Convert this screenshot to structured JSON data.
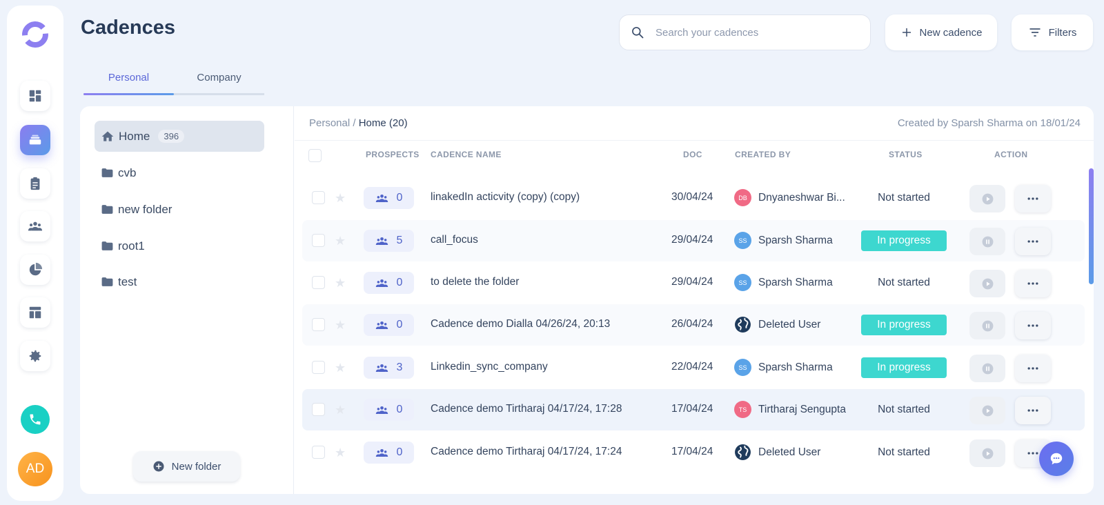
{
  "header": {
    "title": "Cadences",
    "search_placeholder": "Search your cadences",
    "new_cadence_label": "New cadence",
    "filters_label": "Filters"
  },
  "tabs": [
    {
      "label": "Personal",
      "active": true
    },
    {
      "label": "Company",
      "active": false
    }
  ],
  "sidebar": {
    "user_initials": "AD"
  },
  "folders": {
    "items": [
      {
        "label": "Home",
        "count": "396",
        "active": true
      },
      {
        "label": "cvb"
      },
      {
        "label": "new folder"
      },
      {
        "label": "root1"
      },
      {
        "label": "test"
      }
    ],
    "new_folder_label": "New folder"
  },
  "breadcrumb": {
    "root": "Personal /",
    "current": "Home (20)"
  },
  "created_info": "Created by Sparsh Sharma on 18/01/24",
  "table": {
    "columns": {
      "prospects": "PROSPECTS",
      "name": "CADENCE NAME",
      "doc": "DOC",
      "created_by": "CREATED BY",
      "status": "STATUS",
      "action": "ACTION"
    },
    "rows": [
      {
        "prospects": "0",
        "name": "linakedIn acticvity (copy) (copy)",
        "doc": "30/04/24",
        "creator_initials": "DB",
        "creator": "Dnyaneshwar Bi...",
        "status": "Not started"
      },
      {
        "prospects": "5",
        "name": "call_focus",
        "doc": "29/04/24",
        "creator_initials": "SS",
        "creator": "Sparsh Sharma",
        "status": "In progress"
      },
      {
        "prospects": "0",
        "name": "to delete the folder",
        "doc": "29/04/24",
        "creator_initials": "SS",
        "creator": "Sparsh Sharma",
        "status": "Not started"
      },
      {
        "prospects": "0",
        "name": "Cadence demo Dialla 04/26/24, 20:13",
        "doc": "26/04/24",
        "creator_initials": "",
        "creator": "Deleted User",
        "status": "In progress"
      },
      {
        "prospects": "3",
        "name": "Linkedin_sync_company",
        "doc": "22/04/24",
        "creator_initials": "SS",
        "creator": "Sparsh Sharma",
        "status": "In progress"
      },
      {
        "prospects": "0",
        "name": "Cadence demo Tirtharaj 04/17/24, 17:28",
        "doc": "17/04/24",
        "creator_initials": "TS",
        "creator": "Tirtharaj Sengupta",
        "status": "Not started"
      },
      {
        "prospects": "0",
        "name": "Cadence demo Tirtharaj 04/17/24, 17:24",
        "doc": "17/04/24",
        "creator_initials": "",
        "creator": "Deleted User",
        "status": "Not started"
      }
    ]
  },
  "colors": {
    "accent": "#5b67d8",
    "in_progress": "#3dd7cf",
    "avatar_db": "#f06a85",
    "avatar_ss": "#5aa3e8",
    "avatar_ts": "#f06a85"
  }
}
